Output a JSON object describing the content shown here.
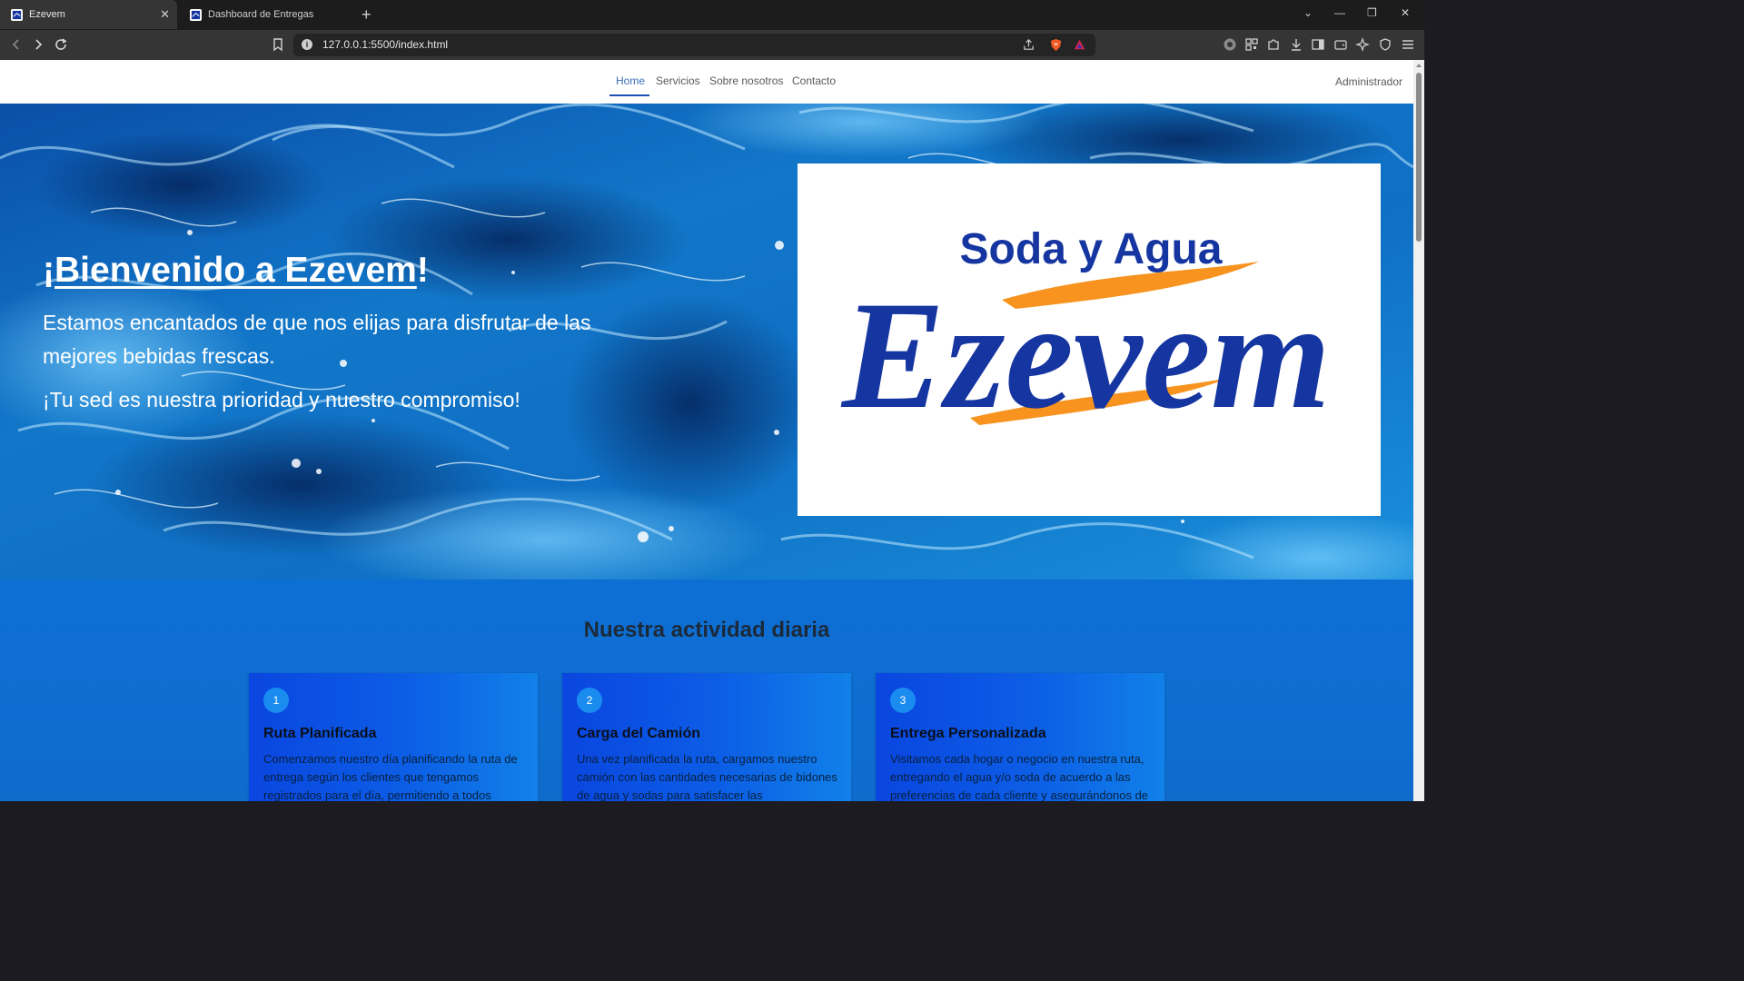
{
  "browser": {
    "tabs": [
      {
        "label": "Ezevem",
        "active": true
      },
      {
        "label": "Dashboard de Entregas",
        "active": false
      }
    ],
    "url": "127.0.0.1:5500/index.html"
  },
  "nav": {
    "links": [
      "Home",
      "Servicios",
      "Sobre nosotros",
      "Contacto"
    ],
    "active": "Home",
    "admin": "Administrador"
  },
  "hero": {
    "title_prefix": "¡",
    "title_link": "Bienvenido a Ezevem",
    "title_suffix": "!",
    "paragraph1": "Estamos encantados de que nos elijas para disfrutar de las mejores bebidas frescas.",
    "paragraph2": "¡Tu sed es nuestra prioridad y nuestro compromiso!"
  },
  "logo": {
    "tagline": "Soda y Agua",
    "brand": "Ezevem",
    "colors": {
      "navy": "#1535a0",
      "orange": "#f7931e"
    }
  },
  "activity": {
    "title": "Nuestra actividad diaria",
    "cards": [
      {
        "number": "1",
        "title": "Ruta Planificada",
        "text": "Comenzamos nuestro día planificando la ruta de entrega según los clientes que tengamos registrados para el día, permitiendo a todos"
      },
      {
        "number": "2",
        "title": "Carga del Camión",
        "text": "Una vez planificada la ruta, cargamos nuestro camión con las cantidades necesarias de bidones de agua y sodas para satisfacer las"
      },
      {
        "number": "3",
        "title": "Entrega Personalizada",
        "text": "Visitamos cada hogar o negocio en nuestra ruta, entregando el agua y/o soda de acuerdo a las preferencias de cada cliente y asegurándonos de"
      }
    ]
  }
}
